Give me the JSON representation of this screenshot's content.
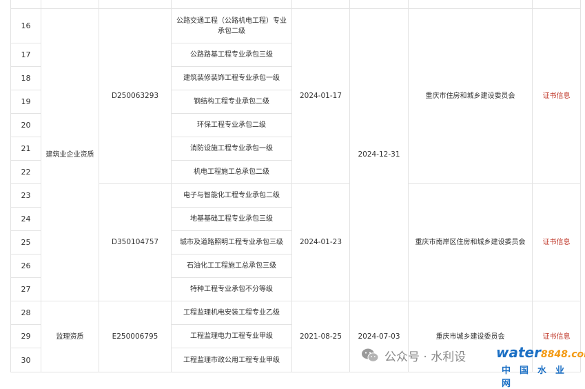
{
  "rows": [
    {
      "num": "16",
      "name": "公路交通工程（公路机电工程）专业承包二级"
    },
    {
      "num": "17",
      "name": "公路路基工程专业承包三级"
    },
    {
      "num": "18",
      "name": "建筑装修装饰工程专业承包一级"
    },
    {
      "num": "19",
      "name": "钢结构工程专业承包二级"
    },
    {
      "num": "20",
      "name": "环保工程专业承包二级"
    },
    {
      "num": "21",
      "name": "消防设施工程专业承包一级"
    },
    {
      "num": "22",
      "name": "机电工程施工总承包二级"
    },
    {
      "num": "23",
      "name": "电子与智能化工程专业承包二级"
    },
    {
      "num": "24",
      "name": "地基基础工程专业承包三级"
    },
    {
      "num": "25",
      "name": "城市及道路照明工程专业承包三级"
    },
    {
      "num": "26",
      "name": "石油化工工程施工总承包三级"
    },
    {
      "num": "27",
      "name": "特种工程专业承包不分等级"
    },
    {
      "num": "28",
      "name": "工程监理机电安装工程专业乙级"
    },
    {
      "num": "29",
      "name": "工程监理电力工程专业甲级"
    },
    {
      "num": "30",
      "name": "工程监理市政公用工程专业甲级"
    }
  ],
  "groups": {
    "construction": {
      "type": "建筑业企业资质",
      "expiry": "2024-12-31",
      "certs": [
        {
          "cert_no": "D250063293",
          "issue": "2024-01-17",
          "authority": "重庆市住房和城乡建设委员会",
          "link": "证书信息"
        },
        {
          "cert_no": "D350104757",
          "issue": "2024-01-23",
          "authority": "重庆市南岸区住房和城乡建设委员会",
          "link": "证书信息"
        }
      ]
    },
    "supervision": {
      "type": "监理资质",
      "cert_no": "E250006795",
      "issue": "2021-08-25",
      "expiry": "2024-07-03",
      "authority": "重庆市城乡建设委员会",
      "link": "证书信息"
    }
  },
  "watermark": {
    "text": "公众号 · 水利设",
    "logo_main": "water",
    "logo_num": "8848",
    "logo_suffix": ".com",
    "logo_sub": "中国水业网"
  },
  "colors": {
    "link": "#c0392b",
    "border": "#e3e3e3",
    "logo_blue": "#1b6fc4",
    "logo_orange": "#f39a13"
  }
}
